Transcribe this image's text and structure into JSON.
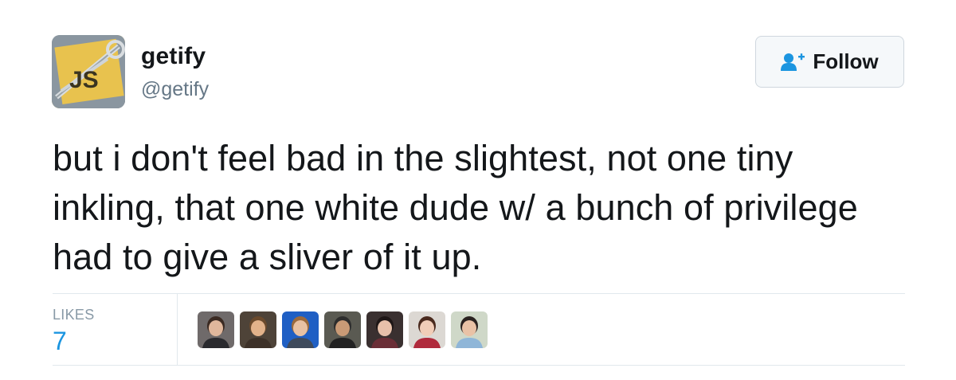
{
  "author": {
    "name": "getify",
    "handle": "@getify",
    "avatar_icon": "js-safety-pin-avatar",
    "avatar_text": "JS"
  },
  "follow_button": {
    "label": "Follow",
    "icon": "add-user-icon",
    "icon_color": "#1b95e0"
  },
  "tweet": {
    "text": "but i don't feel bad in the slightest, not one tiny inkling, that one white dude w/ a bunch of privilege had to give a sliver of it up."
  },
  "stats": {
    "likes_label": "LIKES",
    "likes_count": "7",
    "count_color": "#1b95e0"
  },
  "likers": [
    {
      "icon": "user-avatar-icon",
      "bg": "#6f6a6a",
      "skin": "#e0b79c",
      "hair": "#3b2a22",
      "shirt": "#2a2a2e"
    },
    {
      "icon": "user-avatar-icon",
      "bg": "#4e4338",
      "skin": "#e2b28a",
      "hair": "#6b4a2c",
      "shirt": "#3d3128"
    },
    {
      "icon": "user-avatar-icon",
      "bg": "#1f5fc4",
      "skin": "#e8c1a3",
      "hair": "#9c6a3c",
      "shirt": "#3e4a5c"
    },
    {
      "icon": "user-avatar-icon",
      "bg": "#5a5a52",
      "skin": "#c99a76",
      "hair": "#2d2d2d",
      "shirt": "#222222"
    },
    {
      "icon": "user-avatar-icon",
      "bg": "#3a3030",
      "skin": "#e7c0aa",
      "hair": "#1e1616",
      "shirt": "#6a2e36"
    },
    {
      "icon": "user-avatar-icon",
      "bg": "#dcd8d3",
      "skin": "#f1cdb8",
      "hair": "#4a2a1e",
      "shirt": "#b02a3c"
    },
    {
      "icon": "user-avatar-icon",
      "bg": "#cfd8c8",
      "skin": "#e9c2a6",
      "hair": "#2a2220",
      "shirt": "#8fb6d8"
    }
  ]
}
